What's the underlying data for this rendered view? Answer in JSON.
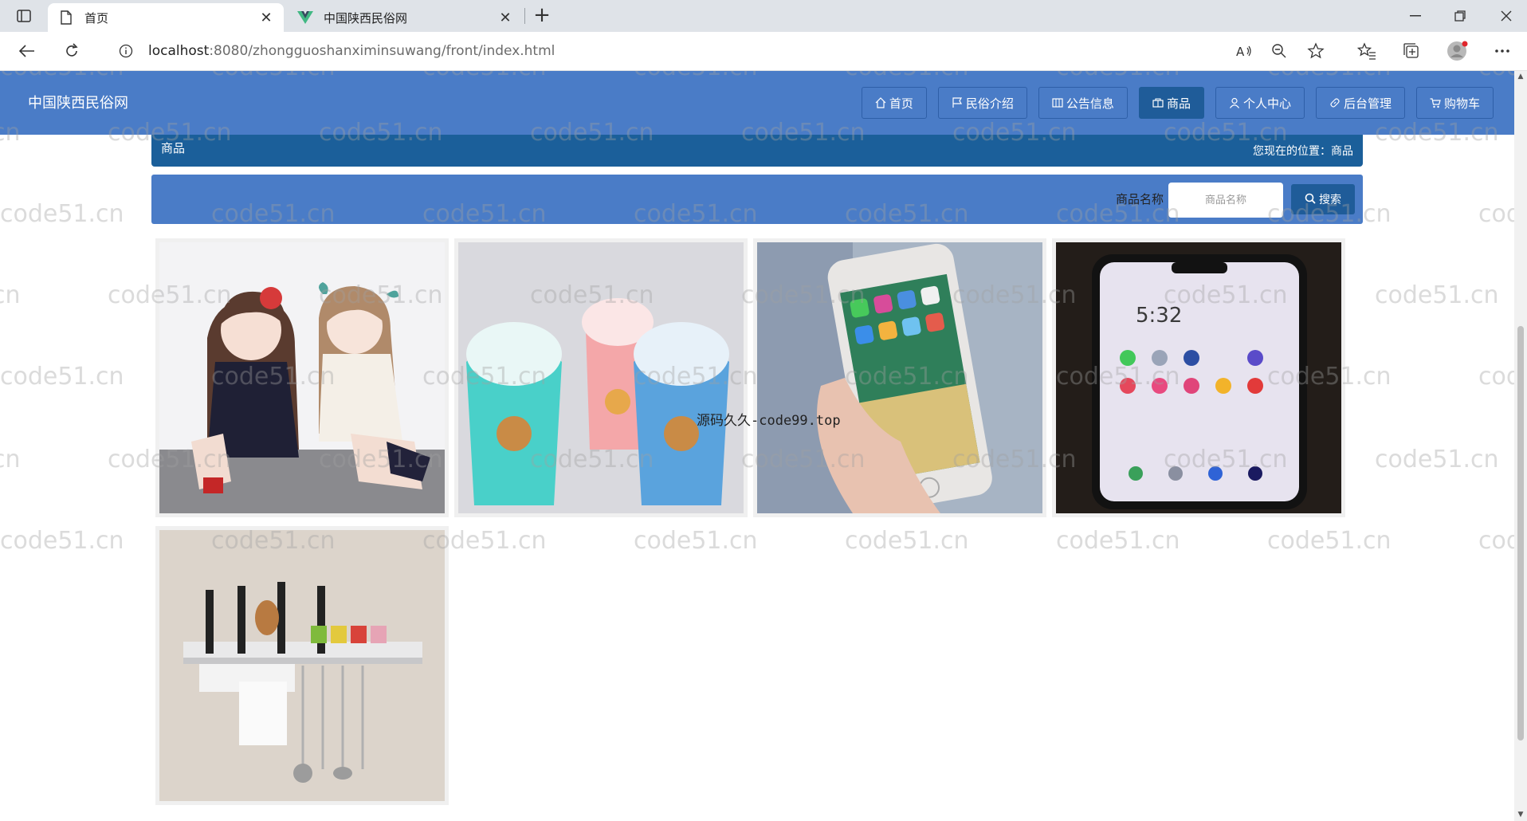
{
  "browser": {
    "tabs": [
      {
        "title": "首页",
        "active": true
      },
      {
        "title": "中国陕西民俗网",
        "active": false
      }
    ],
    "url_host": "localhost",
    "url_rest": ":8080/zhongguoshanximinsuwang/front/index.html"
  },
  "site": {
    "brand": "中国陕西民俗网",
    "nav": [
      {
        "label": "首页",
        "icon": "home-icon"
      },
      {
        "label": "民俗介绍",
        "icon": "flag-icon"
      },
      {
        "label": "公告信息",
        "icon": "notice-icon"
      },
      {
        "label": "商品",
        "icon": "shop-icon",
        "active": true
      },
      {
        "label": "个人中心",
        "icon": "user-icon"
      },
      {
        "label": "后台管理",
        "icon": "link-icon"
      },
      {
        "label": "购物车",
        "icon": "cart-icon"
      }
    ],
    "accent": "#4a7cc7",
    "accent_dark": "#1f5c99"
  },
  "breadcrumb": {
    "section": "商品",
    "location_label": "您现在的位置：",
    "location_value": "商品"
  },
  "search": {
    "label": "商品名称",
    "placeholder": "商品名称",
    "button": "搜索"
  },
  "products": [
    {
      "image": "anime-girls-illustration"
    },
    {
      "image": "kids-plastic-cups"
    },
    {
      "image": "smartphone-in-hand"
    },
    {
      "image": "smartphone-home-screen"
    },
    {
      "image": "kitchen-utensil-rack"
    }
  ],
  "overlay_text": "源码久久-code99.top",
  "watermark": "code51.cn"
}
